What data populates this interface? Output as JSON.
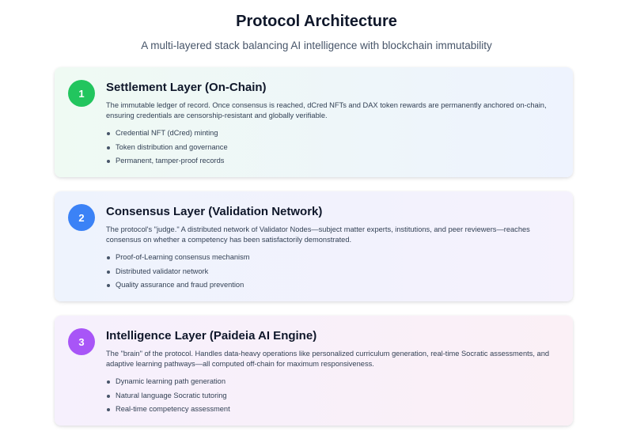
{
  "header": {
    "title": "Protocol Architecture",
    "subtitle": "A multi-layered stack balancing AI intelligence with blockchain immutability"
  },
  "layers": [
    {
      "number": "1",
      "badge_color": "#22c55e",
      "title": "Settlement Layer (On-Chain)",
      "description": "The immutable ledger of record. Once consensus is reached, dCred NFTs and DAX token rewards are permanently anchored on-chain, ensuring credentials are censorship-resistant and globally verifiable.",
      "features": [
        "Credential NFT (dCred) minting",
        "Token distribution and governance",
        "Permanent, tamper-proof records"
      ]
    },
    {
      "number": "2",
      "badge_color": "#3b82f6",
      "title": "Consensus Layer (Validation Network)",
      "description": "The protocol's \"judge.\" A distributed network of Validator Nodes—subject matter experts, institutions, and peer reviewers—reaches consensus on whether a competency has been satisfactorily demonstrated.",
      "features": [
        "Proof-of-Learning consensus mechanism",
        "Distributed validator network",
        "Quality assurance and fraud prevention"
      ]
    },
    {
      "number": "3",
      "badge_color": "#a855f7",
      "title": "Intelligence Layer (Paideia AI Engine)",
      "description": "The \"brain\" of the protocol. Handles data-heavy operations like personalized curriculum generation, real-time Socratic assessments, and adaptive learning pathways—all computed off-chain for maximum responsiveness.",
      "features": [
        "Dynamic learning path generation",
        "Natural language Socratic tutoring",
        "Real-time competency assessment"
      ]
    }
  ]
}
